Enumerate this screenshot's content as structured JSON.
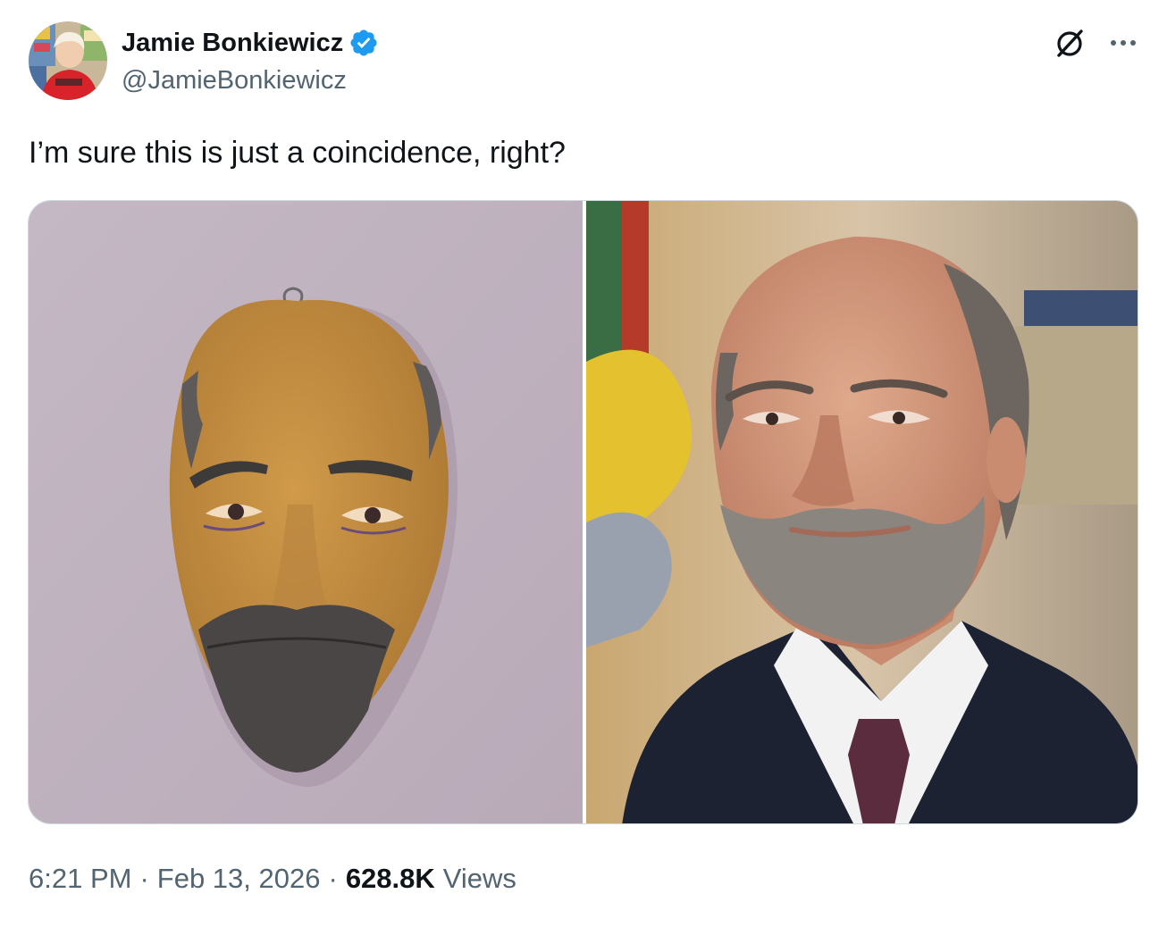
{
  "author": {
    "display_name": "Jamie Bonkiewicz",
    "handle": "@JamieBonkiewicz",
    "verified": true,
    "verified_color": "#1d9bf0",
    "avatar_icon": "profile-photo"
  },
  "tweet": {
    "text": "I’m sure this is just a coincidence, right?"
  },
  "header_actions": {
    "grok_icon": "grok-icon",
    "more_icon": "more-icon"
  },
  "media": [
    {
      "description_icon": "photo-mask"
    },
    {
      "description_icon": "photo-man-portrait"
    }
  ],
  "meta": {
    "time": "6:21 PM",
    "separator": "·",
    "date": "Feb 13, 2026",
    "views_count": "628.8K",
    "views_label": "Views"
  },
  "colors": {
    "text_primary": "#0f1419",
    "text_secondary": "#536471",
    "border": "#cfd9de"
  }
}
